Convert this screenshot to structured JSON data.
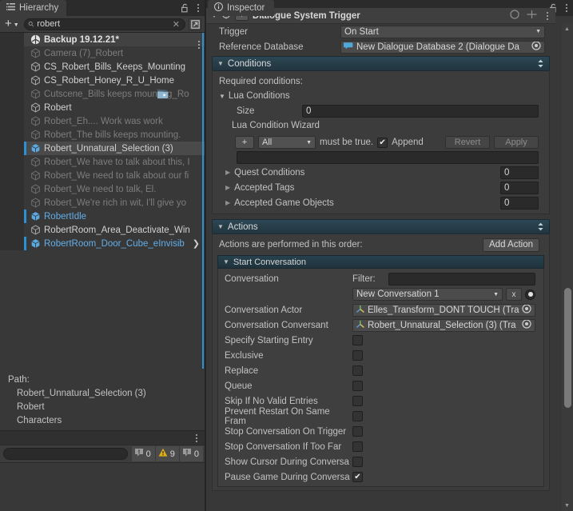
{
  "hierarchy": {
    "tab_label": "Hierarchy",
    "tab_icon": "hierarchy-icon",
    "lock_icon": "lock-open-icon",
    "menu_icon": "kebab-menu-icon",
    "add_button_label": "+",
    "search": {
      "value": "robert",
      "placeholder": "Search",
      "icon": "search-icon",
      "clear_icon": "clear-x-icon"
    },
    "window_button_icon": "open-in-window-icon",
    "items": [
      {
        "label": "Backup 19.12.21*",
        "icon": "unity-scene-icon",
        "style": "scene",
        "indent": 30,
        "accent": false,
        "kebab": true
      },
      {
        "label": "Camera (7)_Robert",
        "icon": "gameobject-icon",
        "style": "disabled",
        "indent": 33,
        "accent": false
      },
      {
        "label": "CS_Robert_Bills_Keeps_Mounting",
        "icon": "gameobject-icon",
        "style": "normal",
        "indent": 33,
        "accent": false
      },
      {
        "label": "CS_Robert_Honey_R_U_Home",
        "icon": "gameobject-icon",
        "style": "normal",
        "indent": 33,
        "accent": false
      },
      {
        "label": "Cutscene_Bills keeps mounting_Ro",
        "icon": "gameobject-icon",
        "style": "disabled",
        "indent": 33,
        "accent": false,
        "clapper": true
      },
      {
        "label": "Robert",
        "icon": "gameobject-icon",
        "style": "normal",
        "indent": 33,
        "accent": false
      },
      {
        "label": "Robert_Eh.... Work was work",
        "icon": "gameobject-icon",
        "style": "disabled",
        "indent": 33,
        "accent": false
      },
      {
        "label": "Robert_The bills keeps mounting.",
        "icon": "gameobject-icon",
        "style": "disabled",
        "indent": 33,
        "accent": false
      },
      {
        "label": "Robert_Unnatural_Selection (3)",
        "icon": "prefab-icon",
        "style": "selected",
        "indent": 30,
        "accent": true
      },
      {
        "label": "Robert_We have to talk about this, I",
        "icon": "gameobject-icon",
        "style": "disabled",
        "indent": 33,
        "accent": false
      },
      {
        "label": "Robert_We need to talk about our fi",
        "icon": "gameobject-icon",
        "style": "disabled",
        "indent": 33,
        "accent": false
      },
      {
        "label": "Robert_We need to talk, El.",
        "icon": "gameobject-icon",
        "style": "disabled",
        "indent": 33,
        "accent": false
      },
      {
        "label": "Robert_We're rich in wit, I'll give yo",
        "icon": "gameobject-icon",
        "style": "disabled",
        "indent": 33,
        "accent": false
      },
      {
        "label": "RobertIdle",
        "icon": "prefab-icon",
        "style": "prefab",
        "indent": 30,
        "accent": true
      },
      {
        "label": "RobertRoom_Area_Deactivate_Win",
        "icon": "gameobject-icon",
        "style": "normal",
        "indent": 33,
        "accent": false
      },
      {
        "label": "RobertRoom_Door_Cube_eInvisib",
        "icon": "prefab-icon",
        "style": "prefab",
        "indent": 30,
        "accent": true,
        "chevron": true
      }
    ],
    "path": {
      "title": "Path:",
      "entries": [
        "Robert_Unnatural_Selection (3)",
        "Robert",
        "Characters"
      ]
    }
  },
  "status_bar": {
    "menu_icon": "kebab-menu-icon",
    "filter_placeholder": "",
    "counters": [
      {
        "icon": "error-icon",
        "count": "0",
        "color": "#9a9a9a"
      },
      {
        "icon": "warning-icon",
        "count": "9",
        "color": "#e0b010"
      },
      {
        "icon": "info-icon",
        "count": "0",
        "color": "#9a9a9a"
      }
    ]
  },
  "inspector": {
    "tab_label": "Inspector",
    "tab_icon": "info-icon",
    "lock_icon": "lock-open-icon",
    "menu_icon": "kebab-menu-icon",
    "component": {
      "title": "Dialogue System Trigger",
      "icon": "script-icon",
      "enabled_icon": "toggle-icon",
      "help_icon": "help-icon",
      "preset_icon": "preset-icon",
      "context_icon": "kebab-menu-icon"
    },
    "trigger": {
      "label": "Trigger",
      "value": "On Start"
    },
    "reference_database": {
      "label": "Reference Database",
      "value": "New Dialogue Database 2 (Dialogue Da",
      "icon": "dialogue-database-icon",
      "picker_icon": "object-picker-icon"
    },
    "conditions": {
      "header": "Conditions",
      "required_label": "Required conditions:",
      "lua_conditions": {
        "label": "Lua Conditions",
        "size_label": "Size",
        "size_value": "0"
      },
      "wizard": {
        "label": "Lua Condition Wizard",
        "add_label": "+",
        "scope_value": "All",
        "must_be_true": "must be true.",
        "append_label": "Append",
        "append_checked": true,
        "revert_label": "Revert",
        "apply_label": "Apply",
        "expression_value": ""
      },
      "folds": [
        {
          "label": "Quest Conditions",
          "value": "0"
        },
        {
          "label": "Accepted Tags",
          "value": "0"
        },
        {
          "label": "Accepted Game Objects",
          "value": "0"
        }
      ]
    },
    "actions": {
      "header": "Actions",
      "order_note": "Actions are performed in this order:",
      "add_action_label": "Add Action",
      "start_conversation": {
        "header": "Start Conversation",
        "conversation_label": "Conversation",
        "filter_label": "Filter:",
        "filter_value": "",
        "conversation_value": "New Conversation 1",
        "clear_label": "x",
        "picker_icon": "radio-picker-icon",
        "actor": {
          "label": "Conversation Actor",
          "value": "Elles_Transform_DONT TOUCH (Tra",
          "icon": "transform-icon",
          "picker_icon": "object-picker-icon"
        },
        "conversant": {
          "label": "Conversation Conversant",
          "value": "Robert_Unnatural_Selection (3) (Tra",
          "icon": "transform-icon",
          "picker_icon": "object-picker-icon"
        },
        "toggles": [
          {
            "label": "Specify Starting Entry",
            "checked": false
          },
          {
            "label": "Exclusive",
            "checked": false
          },
          {
            "label": "Replace",
            "checked": false
          },
          {
            "label": "Queue",
            "checked": false
          },
          {
            "label": "Skip If No Valid Entries",
            "checked": false
          },
          {
            "label": "Prevent Restart On Same Fram",
            "checked": false
          },
          {
            "label": "Stop Conversation On Trigger",
            "checked": false
          },
          {
            "label": "Stop Conversation If Too Far",
            "checked": false
          },
          {
            "label": "Show Cursor During Conversa",
            "checked": false
          },
          {
            "label": "Pause Game During Conversa",
            "checked": true
          }
        ]
      }
    },
    "scrollbar": {
      "up_icon": "scroll-up-icon",
      "down_icon": "scroll-down-icon"
    }
  },
  "colors": {
    "background": "#383838",
    "panel": "#3c3c3c",
    "accent_blue": "#2d8fd5",
    "section_teal": "#2c4754",
    "prefab_blue": "#63aee8",
    "warning": "#e0b010"
  }
}
